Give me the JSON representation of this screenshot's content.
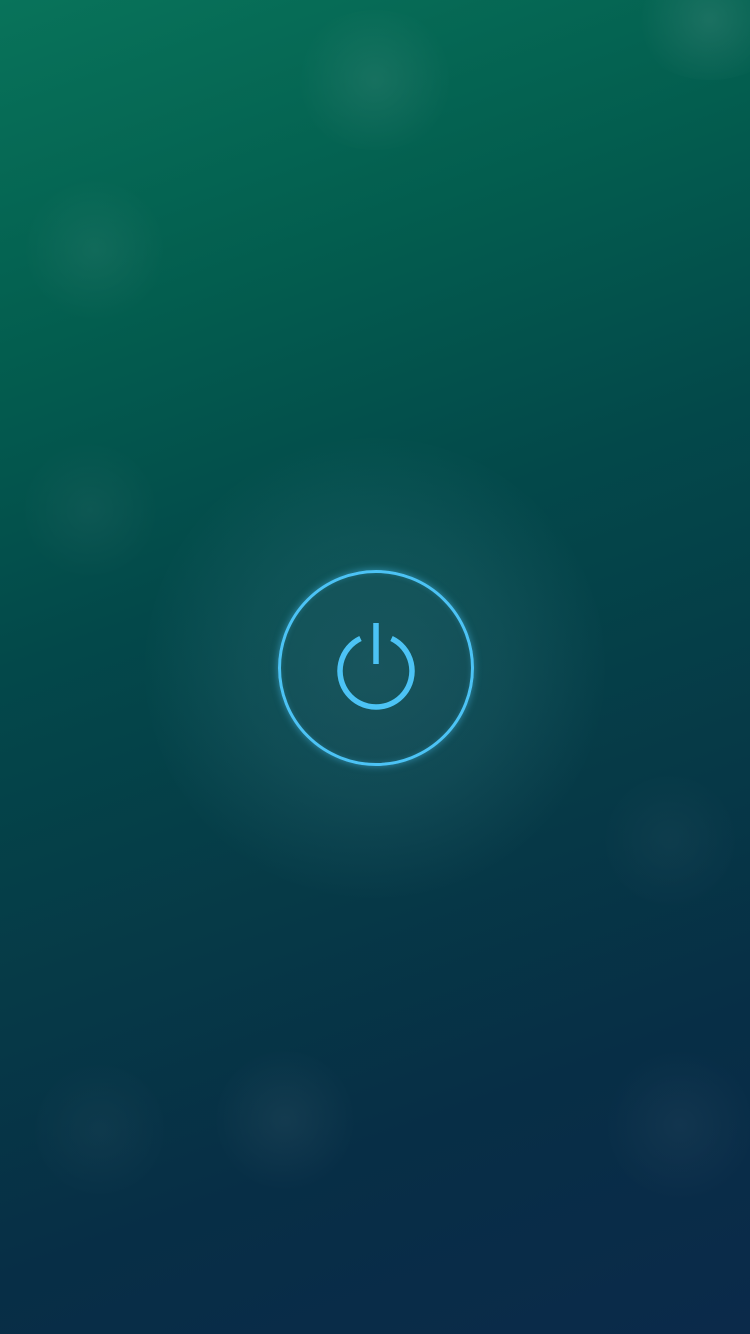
{
  "screen": {
    "name": "power-screen",
    "background_colors": [
      "#08735a",
      "#035e4f",
      "#03484a",
      "#063a47",
      "#072e46",
      "#0b2a4a"
    ]
  },
  "power_button": {
    "icon": "power-icon",
    "accent_color": "#4cc3f5"
  }
}
